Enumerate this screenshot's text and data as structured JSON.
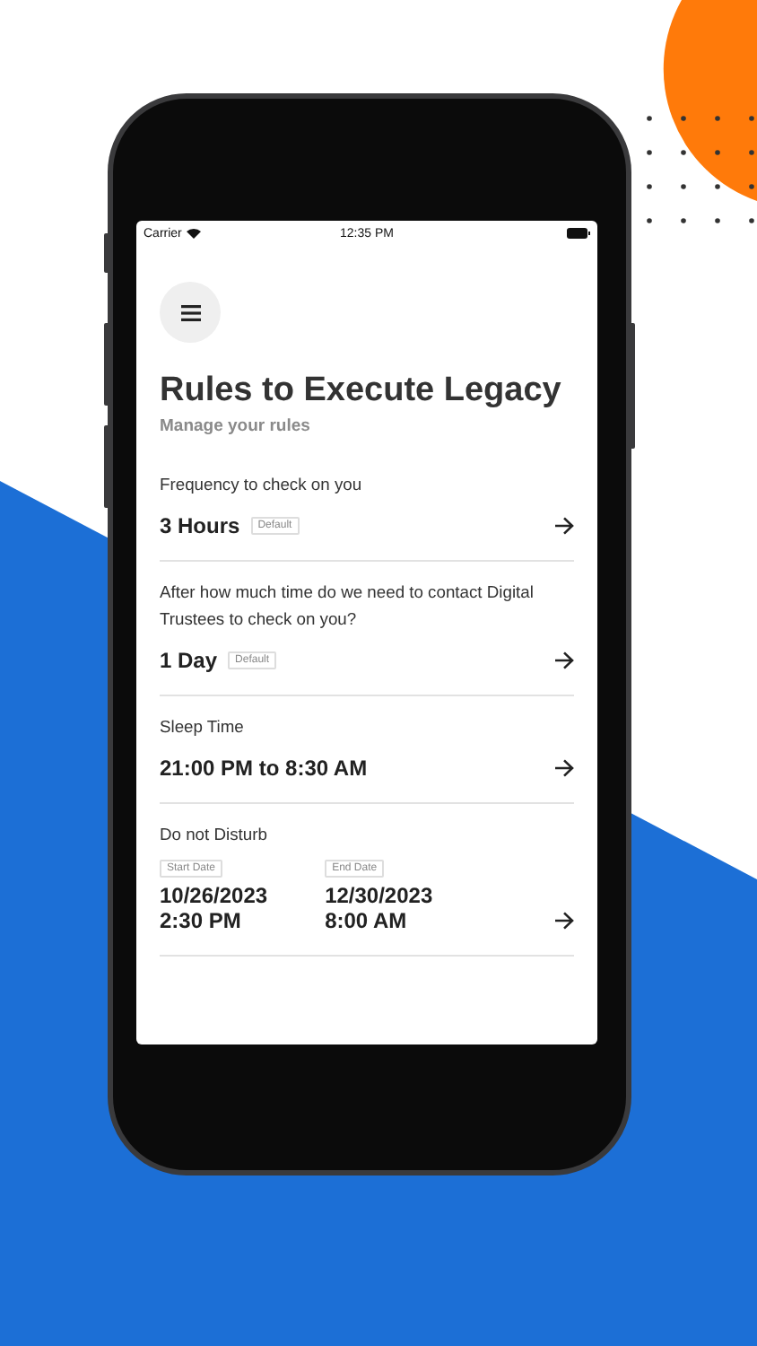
{
  "status_bar": {
    "carrier": "Carrier",
    "time": "12:35 PM"
  },
  "header": {
    "title": "Rules to Execute Legacy",
    "subtitle": "Manage your rules"
  },
  "rules": [
    {
      "kind": "value",
      "label": "Frequency to check on you",
      "value": "3 Hours",
      "badge": "Default"
    },
    {
      "kind": "value",
      "label": "After how much time do we need to contact Digital Trustees to check on you?",
      "value": "1 Day",
      "badge": "Default"
    },
    {
      "kind": "value",
      "label": "Sleep Time",
      "value": "21:00 PM to 8:30 AM"
    },
    {
      "kind": "range",
      "label": "Do not Disturb",
      "start": {
        "badge": "Start Date",
        "date": "10/26/2023",
        "time": "2:30 PM"
      },
      "end": {
        "badge": "End Date",
        "date": "12/30/2023",
        "time": "8:00 AM"
      }
    }
  ]
}
